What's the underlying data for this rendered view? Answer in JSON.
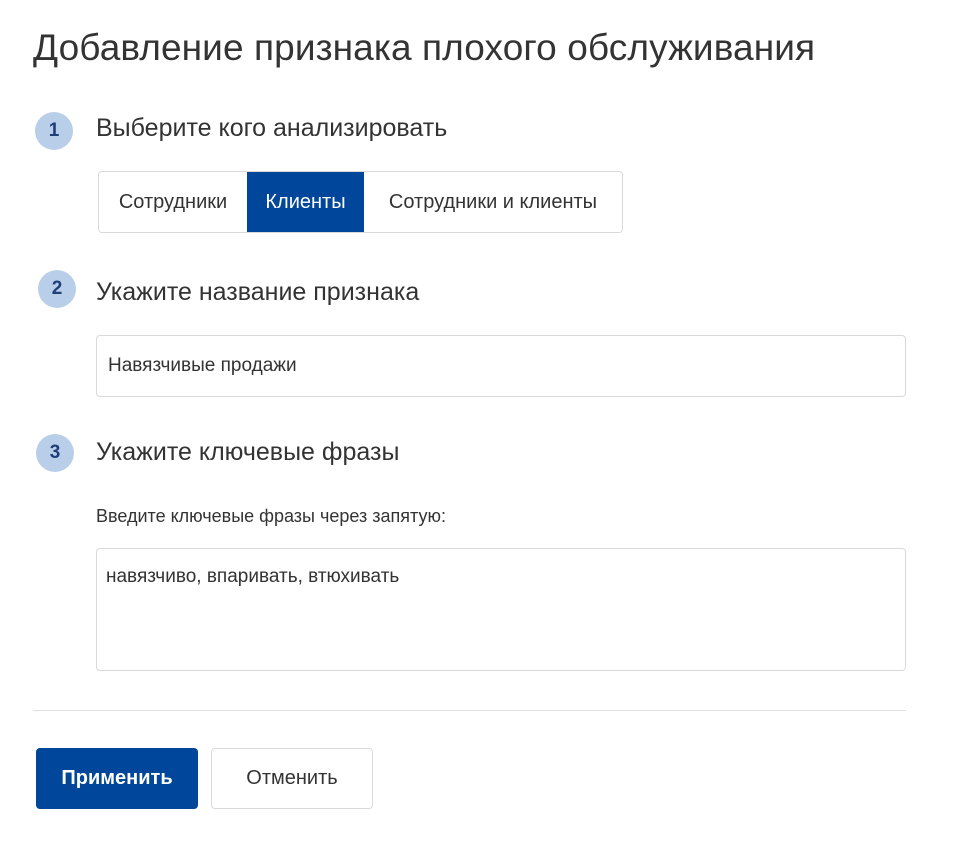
{
  "page": {
    "title": "Добавление признака плохого обслуживания"
  },
  "steps": [
    {
      "number": "1",
      "title": "Выберите кого анализировать",
      "segments": [
        {
          "label": "Сотрудники",
          "selected": false
        },
        {
          "label": "Клиенты",
          "selected": true
        },
        {
          "label": "Сотрудники и клиенты",
          "selected": false
        }
      ]
    },
    {
      "number": "2",
      "title": "Укажите название признака",
      "input_value": "Навязчивые продажи"
    },
    {
      "number": "3",
      "title": "Укажите ключевые фразы",
      "hint": "Введите ключевые фразы через запятую:",
      "textarea_value": "навязчиво, впаривать, втюхивать"
    }
  ],
  "actions": {
    "apply_label": "Применить",
    "cancel_label": "Отменить"
  },
  "colors": {
    "accent": "#00469a",
    "step_badge": "#b9cfe9",
    "text": "#333333",
    "border": "#d9d9d9"
  }
}
